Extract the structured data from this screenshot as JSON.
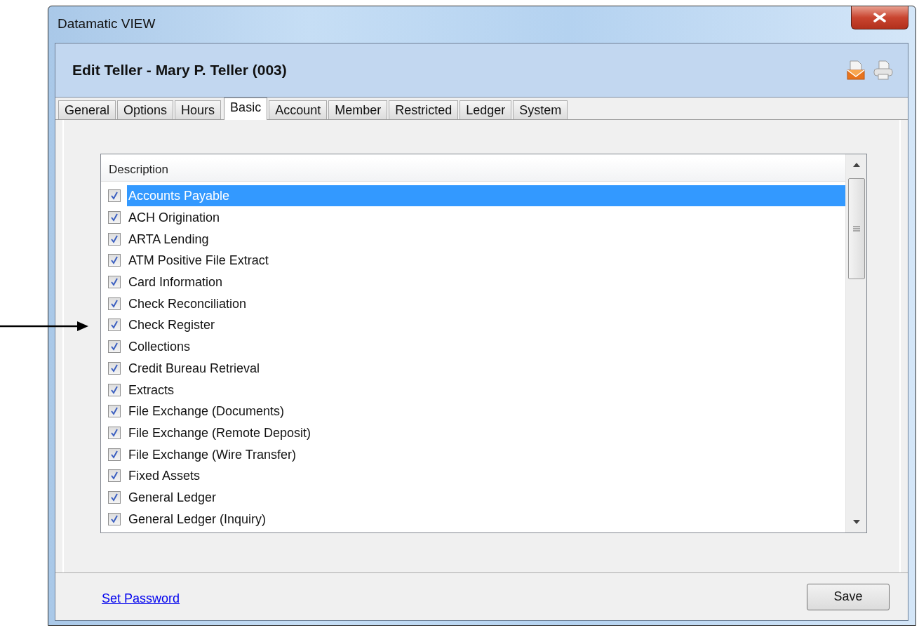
{
  "window": {
    "title": "Datamatic VIEW"
  },
  "header": {
    "title": "Edit Teller - Mary P. Teller (003)"
  },
  "tabs": [
    {
      "label": "General",
      "selected": false
    },
    {
      "label": "Options",
      "selected": false
    },
    {
      "label": "Hours",
      "selected": false
    },
    {
      "label": "Basic",
      "selected": true
    },
    {
      "label": "Account",
      "selected": false
    },
    {
      "label": "Member",
      "selected": false
    },
    {
      "label": "Restricted",
      "selected": false
    },
    {
      "label": "Ledger",
      "selected": false
    },
    {
      "label": "System",
      "selected": false
    }
  ],
  "list": {
    "column": "Description",
    "rows": [
      {
        "label": "Accounts Payable",
        "checked": true,
        "selected": true
      },
      {
        "label": "ACH Origination",
        "checked": true,
        "selected": false
      },
      {
        "label": "ARTA Lending",
        "checked": true,
        "selected": false
      },
      {
        "label": "ATM Positive File Extract",
        "checked": true,
        "selected": false
      },
      {
        "label": "Card Information",
        "checked": true,
        "selected": false
      },
      {
        "label": "Check Reconciliation",
        "checked": true,
        "selected": false
      },
      {
        "label": "Check Register",
        "checked": true,
        "selected": false
      },
      {
        "label": "Collections",
        "checked": true,
        "selected": false
      },
      {
        "label": "Credit Bureau Retrieval",
        "checked": true,
        "selected": false
      },
      {
        "label": "Extracts",
        "checked": true,
        "selected": false
      },
      {
        "label": "File Exchange (Documents)",
        "checked": true,
        "selected": false
      },
      {
        "label": "File Exchange (Remote Deposit)",
        "checked": true,
        "selected": false
      },
      {
        "label": "File Exchange (Wire Transfer)",
        "checked": true,
        "selected": false
      },
      {
        "label": "Fixed Assets",
        "checked": true,
        "selected": false
      },
      {
        "label": "General Ledger",
        "checked": true,
        "selected": false
      },
      {
        "label": "General Ledger (Inquiry)",
        "checked": true,
        "selected": false
      }
    ]
  },
  "footer": {
    "link": "Set Password",
    "button": "Save"
  }
}
